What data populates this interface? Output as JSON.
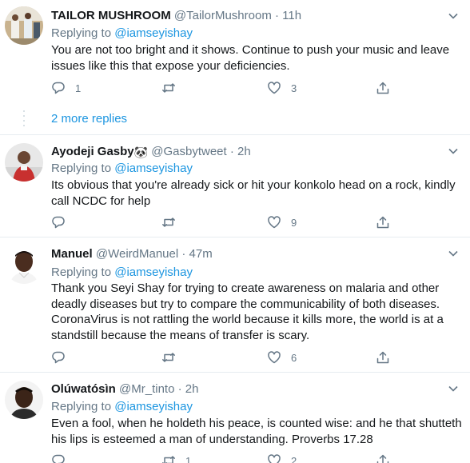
{
  "tweets": [
    {
      "name": "TAILOR MUSHROOM",
      "handle": "@TailorMushroom",
      "dot": "·",
      "time": "11h",
      "replying_label": "Replying to",
      "replying_to": "@iamseyishay",
      "text": "You are not too bright and it shows. Continue to push your music and leave issues like this that expose your deficiencies.",
      "replies": "1",
      "retweets": "",
      "likes": "3"
    },
    {
      "name": "Ayodeji Gasby",
      "name_emoji": "🐼",
      "handle": "@Gasbytweet",
      "dot": "·",
      "time": "2h",
      "replying_label": "Replying to",
      "replying_to": "@iamseyishay",
      "text": "Its obvious that you're already sick or hit your konkolo head on a rock, kindly call NCDC for help",
      "replies": "",
      "retweets": "",
      "likes": "9"
    },
    {
      "name": "Manuel",
      "handle": "@WeirdManuel",
      "dot": "·",
      "time": "47m",
      "replying_label": "Replying to",
      "replying_to": "@iamseyishay",
      "text": "Thank you Seyi Shay for trying to create awareness on malaria and other deadly diseases but try to compare the communicability of both diseases. CoronaVirus is not rattling the world because it kills more, the world is at a standstill because the means of transfer is scary.",
      "replies": "",
      "retweets": "",
      "likes": "6"
    },
    {
      "name": "Olúwatósìn",
      "handle": "@Mr_tinto",
      "dot": "·",
      "time": "2h",
      "replying_label": "Replying to",
      "replying_to": "@iamseyishay",
      "text": "Even a fool, when he holdeth his peace, is counted wise: and he that shutteth his lips is esteemed a man of understanding. Proverbs 17.28",
      "replies": "",
      "retweets": "1",
      "likes": "2"
    }
  ],
  "more_replies": "2 more replies",
  "colors": {
    "text": "#14171a",
    "secondary": "#657786",
    "link": "#1b95e0",
    "divider": "#e6ecf0"
  },
  "icons": [
    "reply-icon",
    "retweet-icon",
    "like-icon",
    "share-icon",
    "caret-down-icon"
  ]
}
